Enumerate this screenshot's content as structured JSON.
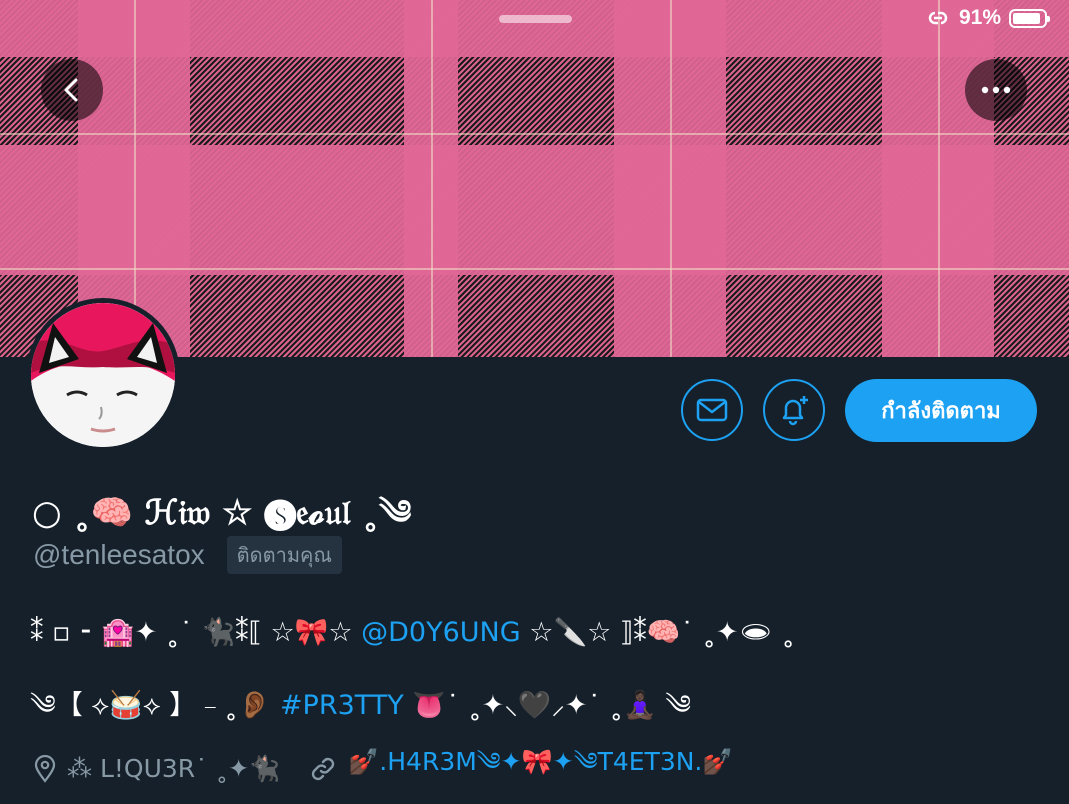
{
  "status_bar": {
    "battery_text": "91%",
    "battery_level": 0.91
  },
  "profile": {
    "display_name": "○ ˳🧠 ℋ𝔦𝔴 ☆ 🅢𝔢𝓸𝔲𝔩 ˳༄",
    "handle": "@tenleesatox",
    "follows_you": "ติดตามคุณ"
  },
  "actions": {
    "follow_state_label": "กำลังติดตาม"
  },
  "bio": {
    "line1_prefix": "⁑ ▫︎ ⁃ 🏩✦ ˳˙ 🐈‍⬛⁑⟦ ☆🎀☆ ",
    "line1_mention": "@D0Y6UNG",
    "line1_suffix": " ☆🔪☆ ⟧⁑🧠˙ ˳✦🕳 ˳",
    "line2_prefix": "༄【 ⟡🥁⟡ 】 ⎯ ˳👂🏾 ",
    "line2_hashtag": "#PR3TTY",
    "line2_suffix": " 👅˙ ˳✦⸜🖤⸝✦˙ ˳🧘🏿‍♀️ ༄"
  },
  "meta": {
    "location": "⁂ L!QU3R˙ ˳✦🐈‍⬛",
    "website": "💅🏿.H4R3M༄✦🎀✦༄T4ET3N.💅🏿"
  },
  "colors": {
    "background": "#15202b",
    "accent": "#1da1f2",
    "secondary_text": "#8899a6",
    "banner_pink": "#e06796"
  }
}
